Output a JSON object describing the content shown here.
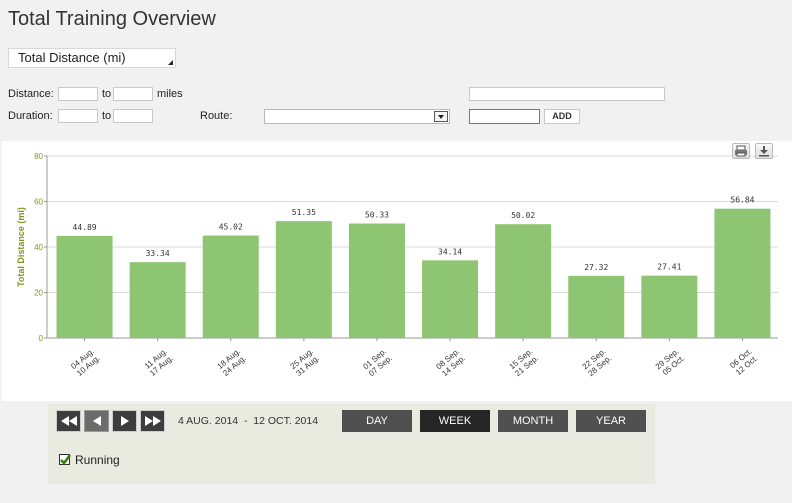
{
  "page": {
    "title": "Total Training Overview"
  },
  "metric_select": {
    "value": "Total Distance (mi)"
  },
  "filters": {
    "distance_label": "Distance:",
    "duration_label": "Duration:",
    "to_label": "to",
    "miles_label": "miles",
    "route_label": "Route:",
    "route_value": "",
    "add_label": "ADD"
  },
  "chart_data": {
    "type": "bar",
    "title": "",
    "xlabel": "",
    "ylabel": "Total Distance (mi)",
    "ylim": [
      0,
      80
    ],
    "yticks": [
      0,
      20,
      40,
      60,
      80
    ],
    "grid": true,
    "bar_color": "#8dc572",
    "categories": [
      [
        "04 Aug.",
        "10 Aug."
      ],
      [
        "11 Aug.",
        "17 Aug."
      ],
      [
        "18 Aug.",
        "24 Aug."
      ],
      [
        "25 Aug.",
        "31 Aug."
      ],
      [
        "01 Sep.",
        "07 Sep."
      ],
      [
        "08 Sep.",
        "14 Sep."
      ],
      [
        "15 Sep.",
        "21 Sep."
      ],
      [
        "22 Sep.",
        "28 Sep."
      ],
      [
        "29 Sep.",
        "05 Oct."
      ],
      [
        "06 Oct.",
        "12 Oct."
      ]
    ],
    "series": [
      {
        "values": [
          44.89,
          33.34,
          45.02,
          51.35,
          50.33,
          34.14,
          50.02,
          27.32,
          27.41,
          56.84
        ]
      }
    ]
  },
  "toolbar": {
    "print_icon": "printer-icon",
    "download_icon": "download-icon"
  },
  "controls": {
    "date_range": "4 AUG. 2014  -  12 OCT. 2014",
    "periods": [
      "DAY",
      "WEEK",
      "MONTH",
      "YEAR"
    ],
    "active_period": "WEEK",
    "legend": {
      "label": "Running",
      "checked": true
    }
  },
  "colors": {
    "accent": "#8dc572",
    "axis_label": "#7a9a1a"
  }
}
